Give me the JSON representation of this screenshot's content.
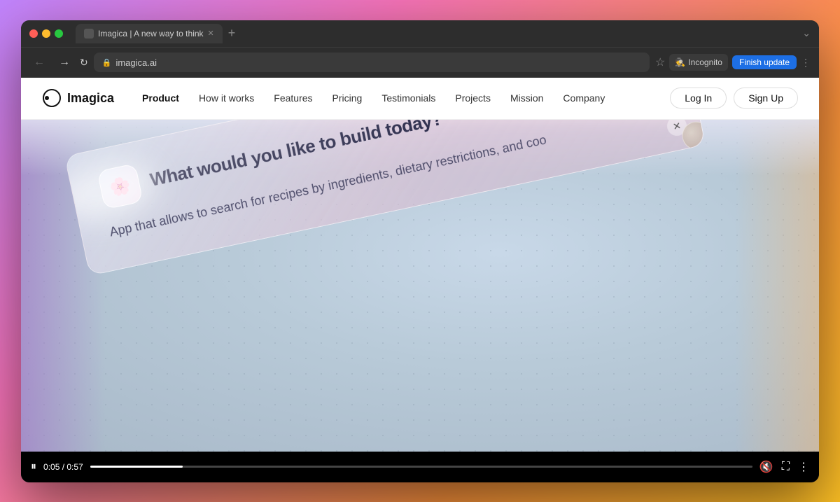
{
  "browser": {
    "tab_title": "Imagica | A new way to think",
    "tab_favicon": "●",
    "url": "imagica.ai",
    "finish_update_label": "Finish update",
    "incognito_label": "Incognito",
    "nav_back": "←",
    "nav_forward": "→",
    "nav_refresh": "↻"
  },
  "site": {
    "logo_text": "Imagica",
    "nav_items": [
      {
        "label": "Product",
        "active": true
      },
      {
        "label": "How it works",
        "active": false
      },
      {
        "label": "Features",
        "active": false
      },
      {
        "label": "Pricing",
        "active": false
      },
      {
        "label": "Testimonials",
        "active": false
      },
      {
        "label": "Projects",
        "active": false
      },
      {
        "label": "Mission",
        "active": false
      },
      {
        "label": "Company",
        "active": false
      }
    ],
    "login_label": "Log In",
    "signup_label": "Sign Up"
  },
  "video": {
    "prompt_heading": "What would you like to build today?",
    "subtext": "App that allows to search for recipes by ingredients, dietary restrictions, and coo",
    "app_icon": "🌸",
    "time_current": "0:05",
    "time_total": "0:57",
    "close_icon": "✕"
  }
}
